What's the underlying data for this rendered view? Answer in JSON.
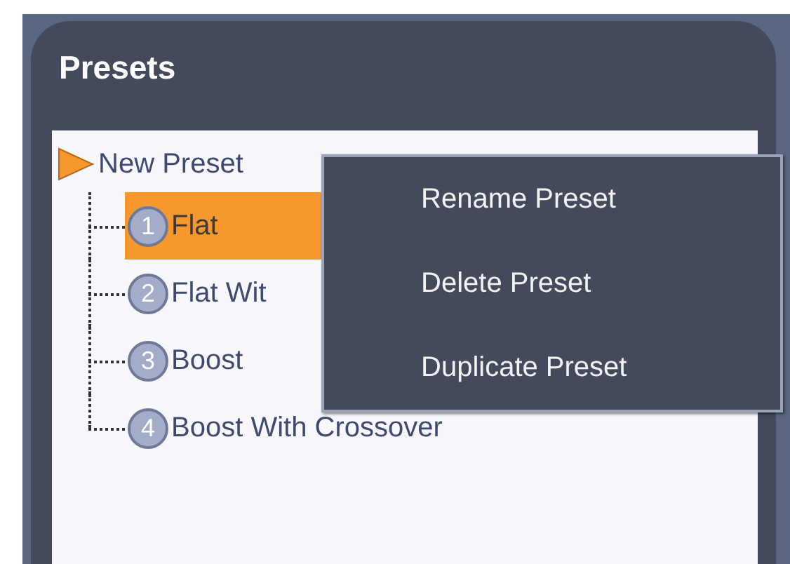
{
  "panel": {
    "title": "Presets"
  },
  "tree": {
    "label": "New Preset",
    "children": [
      {
        "number": "1",
        "label": "Flat",
        "selected": true
      },
      {
        "number": "2",
        "label": "Flat Wit",
        "selected": false
      },
      {
        "number": "3",
        "label": "Boost",
        "selected": false
      },
      {
        "number": "4",
        "label": "Boost With Crossover",
        "selected": false
      }
    ]
  },
  "context_menu": {
    "items": [
      "Rename Preset",
      "Delete Preset",
      "Duplicate Preset"
    ]
  }
}
